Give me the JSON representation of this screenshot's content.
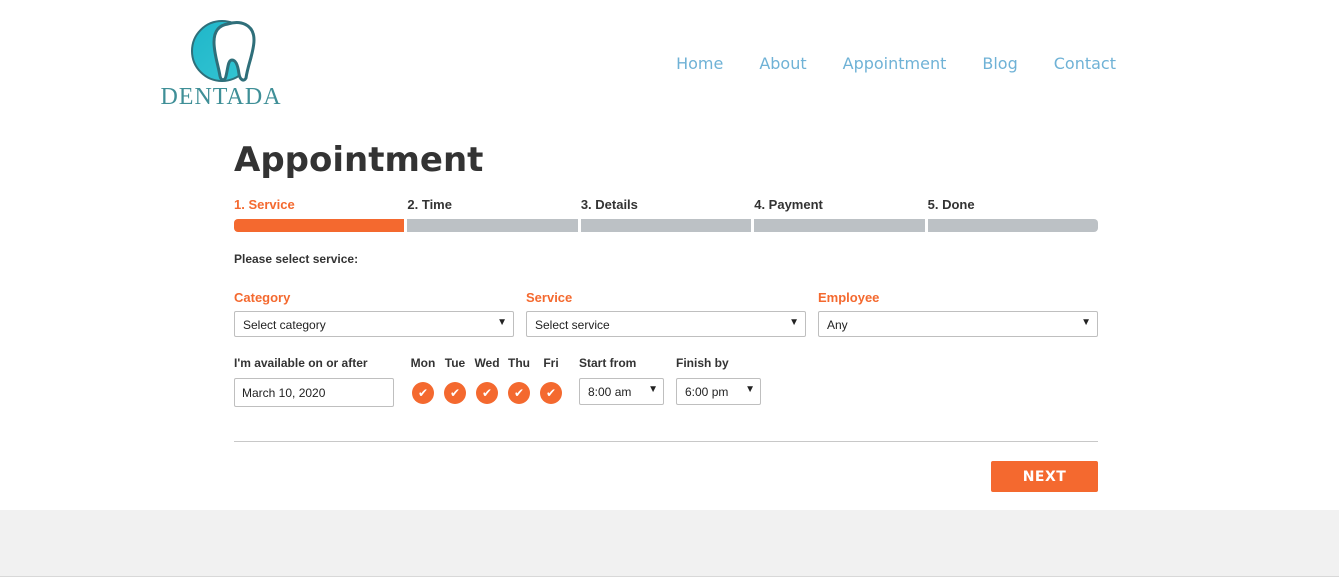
{
  "brand": {
    "name": "DENTADA",
    "primary_color": "#2fbccf",
    "accent_color": "#f4692f"
  },
  "nav": {
    "items": [
      {
        "label": "Home"
      },
      {
        "label": "About"
      },
      {
        "label": "Appointment"
      },
      {
        "label": "Blog"
      },
      {
        "label": "Contact"
      }
    ]
  },
  "page": {
    "title": "Appointment"
  },
  "steps": [
    {
      "label": "1. Service",
      "active": true
    },
    {
      "label": "2. Time",
      "active": false
    },
    {
      "label": "3. Details",
      "active": false
    },
    {
      "label": "4. Payment",
      "active": false
    },
    {
      "label": "5. Done",
      "active": false
    }
  ],
  "form": {
    "prompt": "Please select service:",
    "category": {
      "label": "Category",
      "value": "Select category"
    },
    "service": {
      "label": "Service",
      "value": "Select service"
    },
    "employee": {
      "label": "Employee",
      "value": "Any"
    },
    "date": {
      "label": "I'm available on or after",
      "value": "March 10, 2020"
    },
    "days": [
      {
        "label": "Mon",
        "checked": true
      },
      {
        "label": "Tue",
        "checked": true
      },
      {
        "label": "Wed",
        "checked": true
      },
      {
        "label": "Thu",
        "checked": true
      },
      {
        "label": "Fri",
        "checked": true
      }
    ],
    "start_from": {
      "label": "Start from",
      "value": "8:00 am"
    },
    "finish_by": {
      "label": "Finish by",
      "value": "6:00 pm"
    },
    "next_label": "NEXT"
  },
  "icons": {
    "logo": "tooth-logo-icon",
    "day_check": "checkmark-icon",
    "select_caret": "caret-down-icon"
  }
}
